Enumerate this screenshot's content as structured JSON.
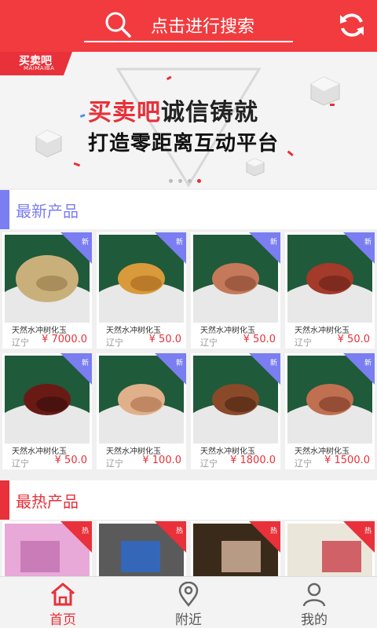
{
  "header": {
    "search_placeholder": "点击进行搜索"
  },
  "banner": {
    "logo_text": "买卖吧",
    "logo_sub": "MAIMAIBA",
    "headline_red": "买卖吧",
    "headline_black": "诚信铸就",
    "subline": "打造零距离互动平台",
    "slides": 4,
    "active_slide": 4
  },
  "newest": {
    "title": "最新产品",
    "accent": "#7a7ef0",
    "tag": "新",
    "products": [
      {
        "name": "天然水冲树化玉",
        "location": "辽宁",
        "price": "¥ 7000.0"
      },
      {
        "name": "天然水冲树化玉",
        "location": "辽宁",
        "price": "¥ 50.0"
      },
      {
        "name": "天然水冲树化玉",
        "location": "辽宁",
        "price": "¥ 50.0"
      },
      {
        "name": "天然水冲树化玉",
        "location": "辽宁",
        "price": "¥ 50.0"
      },
      {
        "name": "天然水冲树化玉",
        "location": "辽宁",
        "price": "¥ 50.0"
      },
      {
        "name": "天然水冲树化玉",
        "location": "辽宁",
        "price": "¥ 100.0"
      },
      {
        "name": "天然水冲树化玉",
        "location": "辽宁",
        "price": "¥ 1800.0"
      },
      {
        "name": "天然水冲树化玉",
        "location": "辽宁",
        "price": "¥ 1500.0"
      }
    ]
  },
  "hottest": {
    "title": "最热产品",
    "accent": "#e8313a",
    "tag": "热"
  },
  "tabbar": {
    "home": "首页",
    "nearby": "附近",
    "mine": "我的"
  },
  "colors": {
    "brand_red": "#f23b3f",
    "price_red": "#e8313a",
    "new_purple": "#7a7ef0"
  }
}
